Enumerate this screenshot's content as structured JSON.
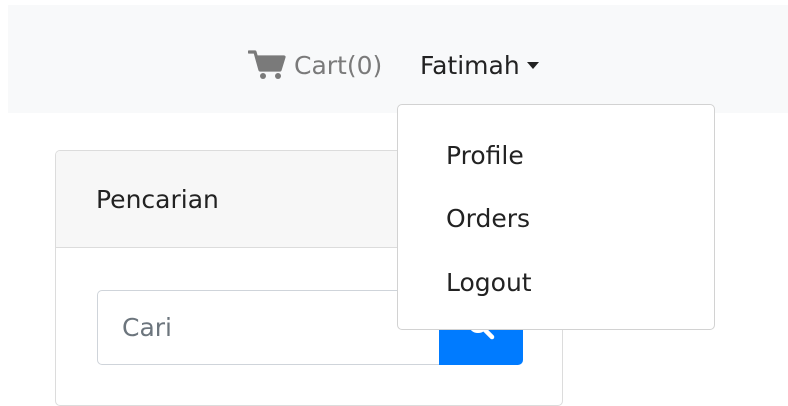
{
  "navbar": {
    "cart_icon": "shopping-cart-icon",
    "cart_label": "Cart(0)",
    "user_name": "Fatimah",
    "caret_icon": "caret-down-icon"
  },
  "user_menu": {
    "items": [
      {
        "label": "Profile"
      },
      {
        "label": "Orders"
      },
      {
        "label": "Logout"
      }
    ]
  },
  "search_card": {
    "title": "Pencarian",
    "input_placeholder": "Cari",
    "input_value": "",
    "button_icon": "search-icon"
  },
  "colors": {
    "navbar_bg": "#f8f9fa",
    "primary": "#007bff",
    "muted_text": "#7a7a7a"
  }
}
